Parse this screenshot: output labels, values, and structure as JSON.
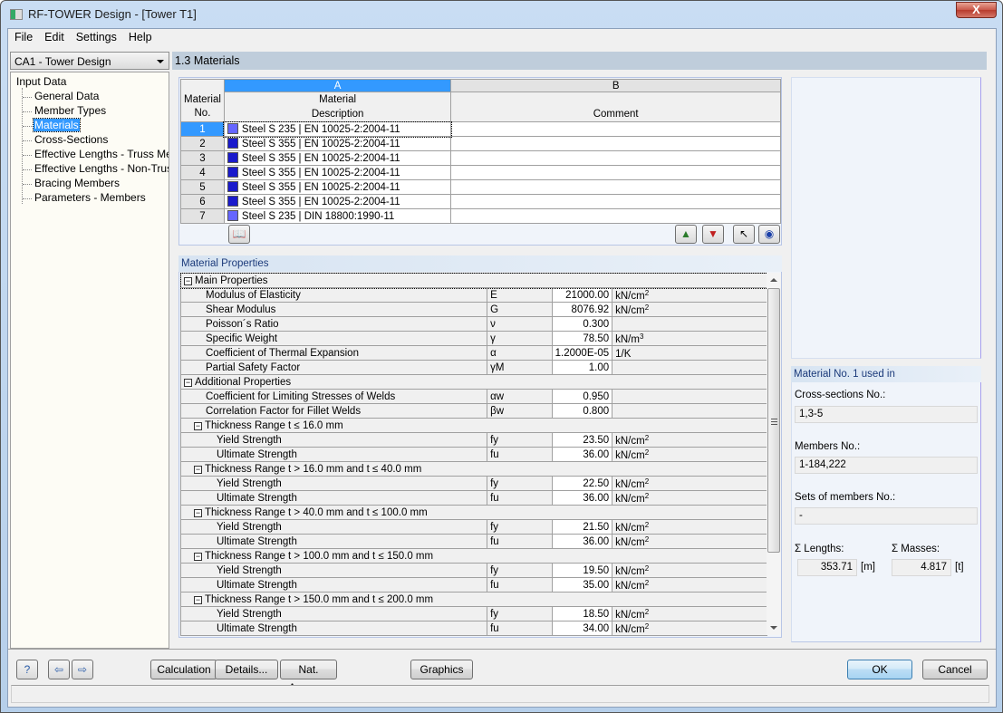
{
  "window": {
    "title": "RF-TOWER Design - [Tower T1]",
    "close_label": "X"
  },
  "menu": [
    "File",
    "Edit",
    "Settings",
    "Help"
  ],
  "case_select": {
    "value": "CA1 - Tower Design"
  },
  "tree": {
    "root": "Input Data",
    "items": [
      {
        "label": "General Data",
        "selected": false
      },
      {
        "label": "Member Types",
        "selected": false
      },
      {
        "label": "Materials",
        "selected": true
      },
      {
        "label": "Cross-Sections",
        "selected": false
      },
      {
        "label": "Effective Lengths - Truss Members",
        "selected": false
      },
      {
        "label": "Effective Lengths - Non-Truss Members",
        "selected": false
      },
      {
        "label": "Bracing Members",
        "selected": false
      },
      {
        "label": "Parameters - Members",
        "selected": false
      }
    ],
    "scroll_thumb_label": "III"
  },
  "section_title": "1.3 Materials",
  "materials_table": {
    "col_letters": [
      "A",
      "B"
    ],
    "hdr_no": [
      "Material",
      "No."
    ],
    "hdr_desc": [
      "Material",
      "Description"
    ],
    "hdr_comment": "Comment",
    "rows": [
      {
        "no": "1",
        "desc": "Steel S 235 | EN 10025-2:2004-11",
        "comment": "",
        "color": "#6666ff"
      },
      {
        "no": "2",
        "desc": "Steel S 355 | EN 10025-2:2004-11",
        "comment": "",
        "color": "#1a1acc"
      },
      {
        "no": "3",
        "desc": "Steel S 355 | EN 10025-2:2004-11",
        "comment": "",
        "color": "#1a1acc"
      },
      {
        "no": "4",
        "desc": "Steel S 355 | EN 10025-2:2004-11",
        "comment": "",
        "color": "#1a1acc"
      },
      {
        "no": "5",
        "desc": "Steel S 355 | EN 10025-2:2004-11",
        "comment": "",
        "color": "#1a1acc"
      },
      {
        "no": "6",
        "desc": "Steel S 355 | EN 10025-2:2004-11",
        "comment": "",
        "color": "#1a1acc"
      },
      {
        "no": "7",
        "desc": "Steel S 235 | DIN 18800:1990-11",
        "comment": "",
        "color": "#6666ff"
      }
    ]
  },
  "toolbar_icons": {
    "library": "library-icon",
    "excel_export": "excel-export-icon",
    "excel_import": "excel-import-icon",
    "pick": "pick-pointer-icon",
    "view": "eye-icon"
  },
  "material_properties": {
    "title": "Material Properties",
    "groups": [
      {
        "label": "Main Properties",
        "level": 0,
        "rows": [
          {
            "name": "Modulus of Elasticity",
            "symbol": "E",
            "value": "21000.00",
            "unit": "kN/cm",
            "unit_sup": "2"
          },
          {
            "name": "Shear Modulus",
            "symbol": "G",
            "value": "8076.92",
            "unit": "kN/cm",
            "unit_sup": "2"
          },
          {
            "name": "Poisson´s Ratio",
            "symbol": "ν",
            "value": "0.300",
            "unit": "",
            "unit_sup": ""
          },
          {
            "name": "Specific Weight",
            "symbol": "γ",
            "value": "78.50",
            "unit": "kN/m",
            "unit_sup": "3"
          },
          {
            "name": "Coefficient of Thermal Expansion",
            "symbol": "α",
            "value": "1.2000E-05",
            "unit": "1/K",
            "unit_sup": ""
          },
          {
            "name": "Partial Safety Factor",
            "symbol": "γM",
            "value": "1.00",
            "unit": "",
            "unit_sup": ""
          }
        ]
      },
      {
        "label": "Additional Properties",
        "level": 0,
        "rows": [
          {
            "name": "Coefficient for Limiting Stresses of Welds",
            "symbol": "αw",
            "value": "0.950",
            "unit": "",
            "unit_sup": ""
          },
          {
            "name": "Correlation Factor for Fillet Welds",
            "symbol": "βw",
            "value": "0.800",
            "unit": "",
            "unit_sup": ""
          }
        ]
      },
      {
        "label": "Thickness Range t ≤ 16.0 mm",
        "level": 1,
        "rows": [
          {
            "name": "Yield Strength",
            "symbol": "fy",
            "value": "23.50",
            "unit": "kN/cm",
            "unit_sup": "2"
          },
          {
            "name": "Ultimate Strength",
            "symbol": "fu",
            "value": "36.00",
            "unit": "kN/cm",
            "unit_sup": "2"
          }
        ]
      },
      {
        "label": "Thickness Range t > 16.0 mm and t ≤ 40.0 mm",
        "level": 1,
        "rows": [
          {
            "name": "Yield Strength",
            "symbol": "fy",
            "value": "22.50",
            "unit": "kN/cm",
            "unit_sup": "2"
          },
          {
            "name": "Ultimate Strength",
            "symbol": "fu",
            "value": "36.00",
            "unit": "kN/cm",
            "unit_sup": "2"
          }
        ]
      },
      {
        "label": "Thickness Range t > 40.0 mm and t ≤ 100.0 mm",
        "level": 1,
        "rows": [
          {
            "name": "Yield Strength",
            "symbol": "fy",
            "value": "21.50",
            "unit": "kN/cm",
            "unit_sup": "2"
          },
          {
            "name": "Ultimate Strength",
            "symbol": "fu",
            "value": "36.00",
            "unit": "kN/cm",
            "unit_sup": "2"
          }
        ]
      },
      {
        "label": "Thickness Range t > 100.0 mm and t ≤ 150.0 mm",
        "level": 1,
        "rows": [
          {
            "name": "Yield Strength",
            "symbol": "fy",
            "value": "19.50",
            "unit": "kN/cm",
            "unit_sup": "2"
          },
          {
            "name": "Ultimate Strength",
            "symbol": "fu",
            "value": "35.00",
            "unit": "kN/cm",
            "unit_sup": "2"
          }
        ]
      },
      {
        "label": "Thickness Range t > 150.0 mm and t ≤ 200.0 mm",
        "level": 1,
        "rows": [
          {
            "name": "Yield Strength",
            "symbol": "fy",
            "value": "18.50",
            "unit": "kN/cm",
            "unit_sup": "2"
          },
          {
            "name": "Ultimate Strength",
            "symbol": "fu",
            "value": "34.00",
            "unit": "kN/cm",
            "unit_sup": "2"
          }
        ]
      }
    ]
  },
  "used_in": {
    "title": "Material No. 1 used in",
    "cross_sections_label": "Cross-sections No.:",
    "cross_sections_value": "1,3-5",
    "members_label": "Members No.:",
    "members_value": "1-184,222",
    "sets_label": "Sets of members No.:",
    "sets_value": "-",
    "lengths_label": "Σ Lengths:",
    "lengths_value": "353.71",
    "lengths_unit": "[m]",
    "masses_label": "Σ Masses:",
    "masses_value": "4.817",
    "masses_unit": "[t]"
  },
  "buttons": {
    "calculation": "Calculation",
    "details": "Details...",
    "nat_annex": "Nat. Annex...",
    "graphics": "Graphics",
    "ok": "OK",
    "cancel": "Cancel"
  },
  "status_text": ""
}
